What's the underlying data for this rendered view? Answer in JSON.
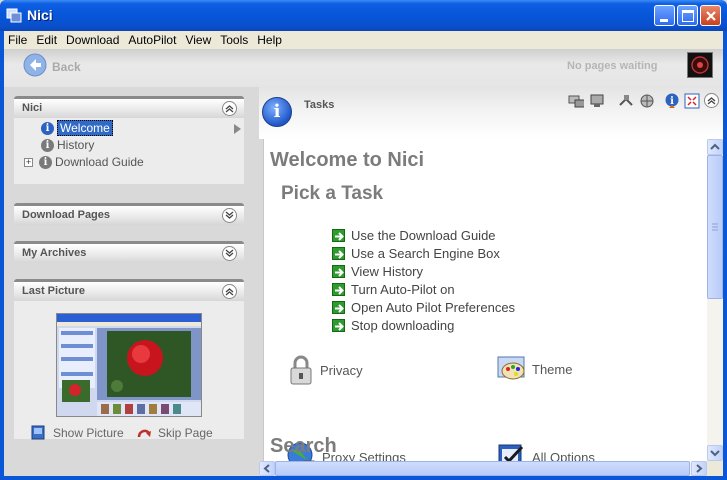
{
  "window": {
    "title": "Nici"
  },
  "menu": [
    "File",
    "Edit",
    "Download",
    "AutoPilot",
    "View",
    "Tools",
    "Help"
  ],
  "toolbar": {
    "back_label": "Back",
    "status": "No pages waiting"
  },
  "left": {
    "nici_panel": {
      "title": "Nici",
      "items": [
        {
          "label": "Welcome",
          "selected": true
        },
        {
          "label": "History"
        },
        {
          "label": "Download Guide",
          "expandable": true
        }
      ]
    },
    "download_pages": {
      "title": "Download Pages"
    },
    "my_archives": {
      "title": "My Archives"
    },
    "last_picture": {
      "title": "Last Picture",
      "show_label": "Show Picture",
      "skip_label": "Skip Page"
    }
  },
  "tasks_header": {
    "label": "Tasks"
  },
  "content": {
    "welcome": "Welcome to Nici",
    "pick": "Pick a Task",
    "tasks": [
      "Use the Download Guide",
      "Use a Search Engine Box",
      "View History",
      "Turn Auto-Pilot on",
      "Open Auto Pilot Preferences",
      "Stop downloading"
    ],
    "options": {
      "privacy": "Privacy",
      "theme": "Theme",
      "proxy": "Proxy Settings",
      "all": "All Options"
    },
    "search": "Search"
  },
  "colors": {
    "titlebar": "#0756d9",
    "accent_green": "#2f9a2f",
    "heading_gray": "#7c7c7c"
  }
}
